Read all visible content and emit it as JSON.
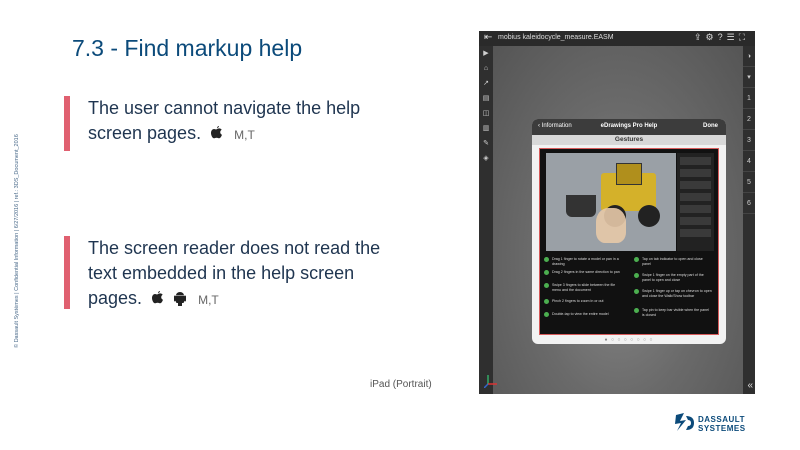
{
  "slide": {
    "title": "7.3 - Find markup help",
    "confidential": "© Dassault Systèmes | Confidential Information | 6/27/2016 | ref.: 3DS_Document_2016"
  },
  "issues": [
    {
      "text": "The user cannot navigate the help screen pages.",
      "platforms": "M,T",
      "os": [
        "apple"
      ]
    },
    {
      "text": "The screen reader does not read the text embedded in the help screen pages.",
      "platforms": "M,T",
      "os": [
        "apple",
        "android"
      ]
    }
  ],
  "caption": "iPad (Portrait)",
  "device": {
    "file_name": "mobius kaleidocycle_measure.EASM",
    "right_tabs": [
      "1",
      "2",
      "3",
      "4",
      "5",
      "6"
    ],
    "help": {
      "back_label": "Information",
      "title": "eDrawings Pro Help",
      "done_label": "Done",
      "section": "Gestures",
      "tips": [
        "Drag 1 finger to rotate a model or pan in a drawing",
        "Drag 2 fingers in the same direction to pan",
        "Swipe 3 fingers to slide between the file menu and the document",
        "Pinch 2 fingers to zoom in or out",
        "Double-tap to view the entire model",
        "Tap on tab indicator to open and close panel",
        "Swipe 1 finger on the empty part of the panel to open and close",
        "Swipe 1 finger up or tap on chevron to open and close the Walk/Show toolbar",
        "Tap pin to keep bar visible when the panel is closed"
      ]
    }
  },
  "logo": {
    "line1": "DASSAULT",
    "line2": "SYSTEMES"
  },
  "colors": {
    "title": "#0b4a7a",
    "accent_bar": "#e06070",
    "highlight_frame": "#d65a5a"
  }
}
